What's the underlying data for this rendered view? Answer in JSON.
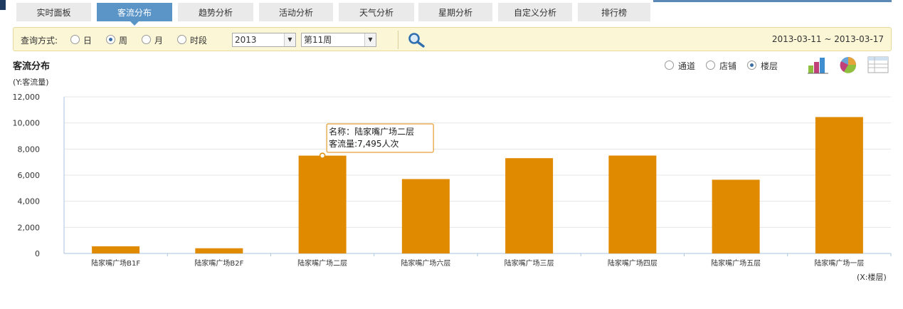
{
  "tabs": [
    {
      "label": "实时面板",
      "active": false
    },
    {
      "label": "客流分布",
      "active": true
    },
    {
      "label": "趋势分析",
      "active": false
    },
    {
      "label": "活动分析",
      "active": false
    },
    {
      "label": "天气分析",
      "active": false
    },
    {
      "label": "星期分析",
      "active": false
    },
    {
      "label": "自定义分析",
      "active": false
    },
    {
      "label": "排行榜",
      "active": false
    }
  ],
  "query": {
    "label": "查询方式:",
    "modes": [
      {
        "label": "日",
        "checked": false
      },
      {
        "label": "周",
        "checked": true
      },
      {
        "label": "月",
        "checked": false
      },
      {
        "label": "时段",
        "checked": false
      }
    ],
    "year": "2013",
    "week": "第11周",
    "date_range": "2013-03-11 ~ 2013-03-17"
  },
  "section": {
    "title": "客流分布",
    "dimensions": [
      {
        "label": "通道",
        "checked": false
      },
      {
        "label": "店铺",
        "checked": false
      },
      {
        "label": "楼层",
        "checked": true
      }
    ],
    "view_icons": [
      "bar-chart-icon",
      "pie-chart-icon",
      "table-icon"
    ]
  },
  "colors": {
    "bar": "#e08a00",
    "active_tab": "#5b95c8",
    "query_bg": "#fbf6d6"
  },
  "chart_data": {
    "type": "bar",
    "ylabel": "(Y:客流量)",
    "xlabel": "(X:楼层)",
    "ylim": [
      0,
      12000
    ],
    "yticks": [
      "0",
      "2,000",
      "4,000",
      "6,000",
      "8,000",
      "10,000",
      "12,000"
    ],
    "categories": [
      "陆家嘴广场B1F",
      "陆家嘴广场B2F",
      "陆家嘴广场二层",
      "陆家嘴广场六层",
      "陆家嘴广场三层",
      "陆家嘴广场四层",
      "陆家嘴广场五层",
      "陆家嘴广场一层"
    ],
    "values": [
      550,
      400,
      7495,
      5700,
      7300,
      7500,
      5650,
      10450
    ],
    "grid": true,
    "tooltip": {
      "category_index": 2,
      "name_line": "名称：陆家嘴广场二层",
      "value_line": "客流量:7,495人次"
    }
  }
}
